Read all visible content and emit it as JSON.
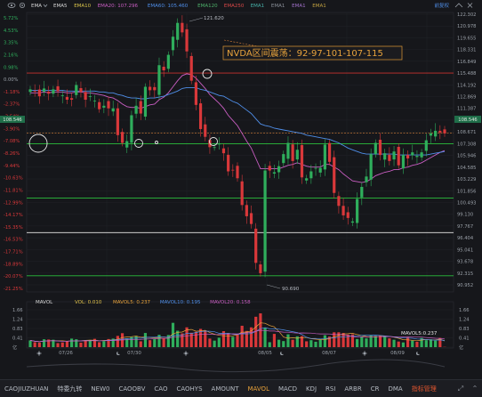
{
  "header": {
    "main_indicator": "EMA",
    "ema_series": [
      {
        "name": "EMA5",
        "value": "",
        "color": "#d8d8d8"
      },
      {
        "name": "EMA10",
        "value": "",
        "color": "#d8c34a"
      },
      {
        "name": "EMA20",
        "value": "107.296",
        "color": "#c95ec2"
      },
      {
        "name": "EMA60",
        "value": "105.460",
        "color": "#4f8ee8"
      },
      {
        "name": "EMA120",
        "value": "",
        "color": "#4db06a"
      },
      {
        "name": "EMA250",
        "value": "",
        "color": "#d94848"
      },
      {
        "name": "EMA1",
        "value": "",
        "color": "#47b0a8"
      },
      {
        "name": "EMA1",
        "value": "",
        "color": "#8a8f98"
      },
      {
        "name": "EMA1",
        "value": "",
        "color": "#a070c8"
      },
      {
        "name": "EMA1",
        "value": "",
        "color": "#c0a040"
      }
    ],
    "right_button": "前复权"
  },
  "annotation": {
    "text": "NVDA区间震荡：92-97-101-107-115",
    "color": "#e8a33c"
  },
  "price_panel": {
    "left_pct_ticks": [
      "5.72%",
      "4.53%",
      "3.35%",
      "2.16%",
      "0.98%",
      "0.00%",
      "-1.18%",
      "-2.37%",
      "-3.54%",
      "-3.90%",
      "-7.08%",
      "-8.26%",
      "-9.44%",
      "-10.63%",
      "-11.81%",
      "-12.99%",
      "-14.17%",
      "-15.35%",
      "-16.53%",
      "-17.71%",
      "-18.89%",
      "-20.07%",
      "-21.25%"
    ],
    "right_price_ticks": [
      "122.302",
      "120.978",
      "119.655",
      "118.331",
      "116.849",
      "115.488",
      "114.192",
      "112.869",
      "111.387",
      "109.546",
      "108.671",
      "107.308",
      "105.946",
      "104.585",
      "103.229",
      "101.856",
      "100.493",
      "99.130",
      "97.767",
      "96.404",
      "95.041",
      "93.678",
      "92.315",
      "90.952"
    ],
    "current_price_tag": "108.546",
    "high_label": "121.620",
    "low_label": "90.690"
  },
  "volume_panel": {
    "title": "MAVOL",
    "series": [
      {
        "name": "VOL",
        "value": "0.010",
        "color": "#e0c24b"
      },
      {
        "name": "MAVOL5",
        "value": "0.237",
        "color": "#e8a33c"
      },
      {
        "name": "MAVOL10",
        "value": "0.195",
        "color": "#4f8ee8"
      },
      {
        "name": "MAVOL20",
        "value": "0.158",
        "color": "#c95ec2"
      }
    ],
    "left_ticks": [
      "1.66",
      "1.24",
      "0.83",
      "0.41",
      "亿"
    ],
    "right_ticks": [
      "1.66",
      "1.24",
      "0.83",
      "0.41",
      "亿"
    ],
    "tag": "MAVOL5:0.237"
  },
  "x_axis": {
    "dates": [
      "07/26",
      "07/30",
      "08/05",
      "08/07",
      "08/09"
    ]
  },
  "tabs": [
    {
      "label": "CAOJIUZHUAN",
      "active": false
    },
    {
      "label": "特委九转",
      "active": false
    },
    {
      "label": "NEW0",
      "active": false
    },
    {
      "label": "CAOOBV",
      "active": false
    },
    {
      "label": "CAO",
      "active": false
    },
    {
      "label": "CAOHYS",
      "active": false
    },
    {
      "label": "AMOUNT",
      "active": false
    },
    {
      "label": "MAVOL",
      "active": true
    },
    {
      "label": "MACD",
      "active": false
    },
    {
      "label": "KDJ",
      "active": false
    },
    {
      "label": "RSI",
      "active": false
    },
    {
      "label": "ARBR",
      "active": false
    },
    {
      "label": "CR",
      "active": false
    },
    {
      "label": "DMA",
      "active": false
    },
    {
      "label": "指标管理",
      "active": false,
      "special": true
    }
  ],
  "colors": {
    "up": "#2fae5c",
    "down": "#d9383a",
    "line_red": "#c8322e",
    "line_green": "#2bbf3c",
    "line_white": "#e8e8e8",
    "line_orange_dash": "#d9833a"
  },
  "chart_data": {
    "type": "line",
    "title": "",
    "series": [
      {
        "name": "Close",
        "values": [
          113.6,
          113.4,
          112.8,
          113.7,
          113.1,
          113.6,
          113.4,
          112.9,
          112.4,
          112.4,
          114.1,
          113.3,
          112.4,
          112.8,
          112.3,
          111.3,
          111.7,
          111.4,
          111.4,
          108.3,
          107.4,
          107.6,
          110.6,
          111.7,
          110.8,
          113.9,
          113.5,
          113.5,
          116.4,
          115.8,
          117.6,
          119.7,
          121.3,
          120.2,
          118.0,
          114.6,
          111.8,
          109.0,
          108.1,
          106.9,
          106.9,
          107.3,
          106.2,
          104.1,
          104.2,
          103.3,
          100.2,
          98.9,
          98.0,
          93.5,
          92.3,
          104.2,
          104.2,
          104.0,
          104.7,
          106.1,
          107.4,
          105.3,
          106.6,
          103.4,
          103.3,
          104.1,
          104.5,
          104.5,
          107.2,
          105.2,
          101.6,
          100.1,
          99.0,
          98.7,
          98.3,
          100.9,
          102.3,
          103.5,
          106.1,
          107.4,
          106.0,
          106.2,
          105.3,
          106.4,
          104.8,
          106.0,
          105.6,
          106.3,
          105.9,
          106.3,
          107.7,
          108.5,
          108.8,
          108.6,
          108.5
        ]
      },
      {
        "name": "EMA20",
        "values": [
          113.2,
          113.2,
          113.2,
          113.3,
          113.2,
          113.3,
          113.3,
          113.3,
          113.2,
          113.2,
          113.3,
          113.3,
          113.2,
          113.2,
          113.1,
          113.0,
          112.9,
          112.7,
          112.6,
          112.3,
          111.9,
          111.6,
          111.5,
          111.5,
          111.4,
          111.6,
          111.8,
          111.9,
          112.4,
          112.7,
          113.2,
          113.9,
          114.6,
          115.2,
          115.4,
          115.3,
          114.9,
          114.3,
          113.7,
          113.0,
          112.5,
          112.0,
          111.4,
          110.6,
          110.0,
          109.4,
          108.5,
          107.6,
          106.8,
          105.6,
          104.4,
          104.4,
          104.4,
          104.4,
          104.4,
          104.6,
          104.8,
          104.9,
          105.1,
          104.9,
          104.7,
          104.6,
          104.6,
          104.6,
          104.9,
          104.9,
          104.6,
          104.3,
          103.8,
          103.4,
          103.0,
          102.9,
          102.8,
          102.9,
          103.2,
          103.6,
          103.8,
          104.0,
          104.1,
          104.3,
          104.3,
          104.5,
          104.6,
          104.8,
          104.9,
          105.1,
          105.4,
          105.7,
          106.0,
          106.3,
          106.5
        ]
      },
      {
        "name": "EMA60",
        "values": [
          113.5,
          113.5,
          113.5,
          113.5,
          113.5,
          113.5,
          113.5,
          113.5,
          113.4,
          113.4,
          113.4,
          113.4,
          113.4,
          113.4,
          113.4,
          113.3,
          113.3,
          113.2,
          113.2,
          113.0,
          112.9,
          112.7,
          112.6,
          112.6,
          112.5,
          112.5,
          112.6,
          112.6,
          112.7,
          112.8,
          113.0,
          113.2,
          113.4,
          113.7,
          113.8,
          113.8,
          113.8,
          113.6,
          113.5,
          113.3,
          113.1,
          112.9,
          112.8,
          112.5,
          112.2,
          112.0,
          111.6,
          111.2,
          110.8,
          110.2,
          109.6,
          109.4,
          109.3,
          109.1,
          109.0,
          108.9,
          108.8,
          108.7,
          108.6,
          108.5,
          108.3,
          108.2,
          108.1,
          108.0,
          107.9,
          107.8,
          107.6,
          107.4,
          107.1,
          106.8,
          106.6,
          106.4,
          106.2,
          106.1,
          106.1,
          106.1,
          106.1,
          106.1,
          106.1,
          106.1,
          106.0,
          106.0,
          106.0,
          106.0,
          106.0,
          106.0,
          106.0,
          106.1,
          106.2,
          106.3,
          106.4
        ]
      }
    ],
    "x": {
      "labels": [
        "07/26",
        "07/30",
        "08/05",
        "08/07",
        "08/09"
      ]
    },
    "ylim": [
      90.952,
      122.302
    ],
    "horizontal_levels": [
      {
        "value": 115.488,
        "color": "#c8322e"
      },
      {
        "value": 107.308,
        "color": "#2bbf3c"
      },
      {
        "value": 101.0,
        "color": "#2bbf3c"
      },
      {
        "value": 97.0,
        "color": "#e8e8e8"
      },
      {
        "value": 92.0,
        "color": "#2bbf3c"
      },
      {
        "value": 108.546,
        "color": "#d9833a",
        "style": "dashed"
      }
    ],
    "volume": {
      "ylim": [
        0,
        1.66
      ],
      "values": [
        0.3,
        0.22,
        0.2,
        0.35,
        0.34,
        0.33,
        0.18,
        0.21,
        0.26,
        0.38,
        0.35,
        0.2,
        0.31,
        0.32,
        0.37,
        0.22,
        0.27,
        0.36,
        0.38,
        0.5,
        0.62,
        0.39,
        0.45,
        0.5,
        0.26,
        0.63,
        0.31,
        0.36,
        0.55,
        0.4,
        0.54,
        1.08,
        0.73,
        0.61,
        0.88,
        0.64,
        0.68,
        0.81,
        0.73,
        0.38,
        0.29,
        0.42,
        0.71,
        0.63,
        0.46,
        0.59,
        0.95,
        0.72,
        0.88,
        1.35,
        1.5,
        0.85,
        0.22,
        0.59,
        0.33,
        0.27,
        0.57,
        0.33,
        0.48,
        0.49,
        0.26,
        0.31,
        0.24,
        0.35,
        0.53,
        0.47,
        0.66,
        0.66,
        0.63,
        0.56,
        0.57,
        0.36,
        0.48,
        0.39,
        0.53,
        0.5,
        0.52,
        0.48,
        0.39,
        0.33,
        0.25,
        0.21,
        0.44,
        0.29,
        0.24,
        0.41,
        0.31,
        0.35,
        0.29,
        0.41,
        0.01
      ]
    }
  }
}
